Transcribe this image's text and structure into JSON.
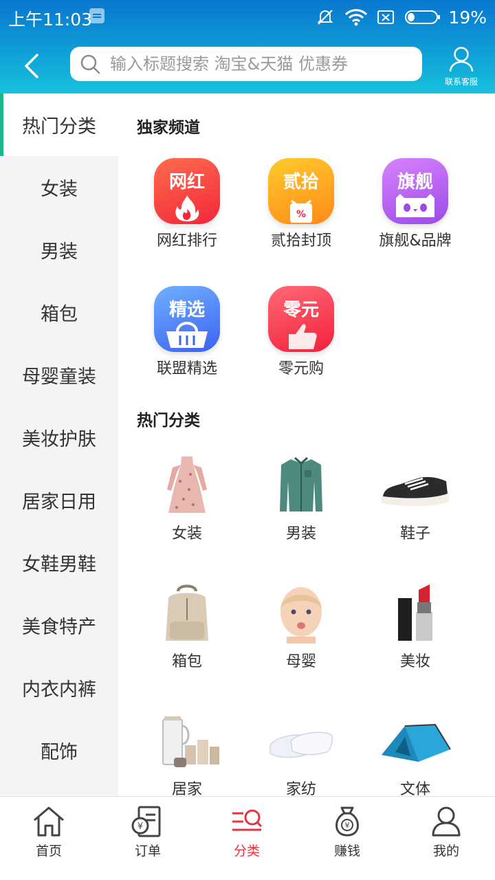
{
  "status_bar": {
    "time": "上午11:03",
    "battery": "19%"
  },
  "header": {
    "search_placeholder": "输入标题搜索 淘宝&天猫 优惠券",
    "service_label": "联系客服"
  },
  "sidebar": {
    "items": [
      {
        "label": "热门分类",
        "active": true
      },
      {
        "label": "女装"
      },
      {
        "label": "男装"
      },
      {
        "label": "箱包"
      },
      {
        "label": "母婴童装"
      },
      {
        "label": "美妆护肤"
      },
      {
        "label": "居家日用"
      },
      {
        "label": "女鞋男鞋"
      },
      {
        "label": "美食特产"
      },
      {
        "label": "内衣内裤"
      },
      {
        "label": "配饰"
      }
    ]
  },
  "exclusive": {
    "title": "独家频道",
    "items": [
      {
        "badge": "网红",
        "label": "网红排行",
        "icon": "flame-icon",
        "color": "#f2283a"
      },
      {
        "badge": "贰拾",
        "label": "贰拾封顶",
        "icon": "discount-icon",
        "color": "#ff8a18"
      },
      {
        "badge": "旗舰",
        "label": "旗舰&品牌",
        "icon": "tmall-cat-icon",
        "color": "#9b4be6"
      },
      {
        "badge": "精选",
        "label": "联盟精选",
        "icon": "basket-icon",
        "color": "#3d62f0"
      },
      {
        "badge": "零元",
        "label": "零元购",
        "icon": "thumbs-up-icon",
        "color": "#f3203d"
      }
    ]
  },
  "hot": {
    "title": "热门分类",
    "items": [
      {
        "label": "女装",
        "icon": "dress-image"
      },
      {
        "label": "男装",
        "icon": "shirt-image"
      },
      {
        "label": "鞋子",
        "icon": "sneaker-image"
      },
      {
        "label": "箱包",
        "icon": "backpack-image"
      },
      {
        "label": "母婴",
        "icon": "baby-image"
      },
      {
        "label": "美妆",
        "icon": "lipstick-image"
      },
      {
        "label": "居家",
        "icon": "cups-image"
      },
      {
        "label": "家纺",
        "icon": "pillows-image"
      },
      {
        "label": "文体",
        "icon": "tent-image"
      }
    ]
  },
  "bottom_nav": {
    "items": [
      {
        "label": "首页",
        "icon": "home-icon"
      },
      {
        "label": "订单",
        "icon": "order-icon"
      },
      {
        "label": "分类",
        "icon": "category-search-icon",
        "active": true
      },
      {
        "label": "赚钱",
        "icon": "money-bag-icon"
      },
      {
        "label": "我的",
        "icon": "profile-icon"
      }
    ]
  },
  "colors": {
    "accent_red": "#e8323c",
    "sidebar_active": "#19b88a",
    "header_blue": "#0a76cf"
  }
}
